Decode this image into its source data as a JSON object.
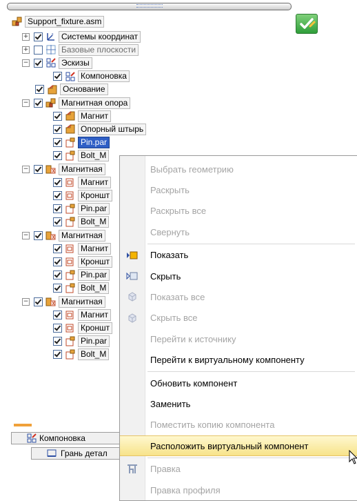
{
  "root": {
    "label": "Support_fixture.asm"
  },
  "tree": [
    {
      "label": "Системы координат",
      "expander": "+",
      "checked": true,
      "icon": "coordinate-system-icon",
      "gray": false
    },
    {
      "label": "Базовые плоскости",
      "expander": "+",
      "checked": false,
      "icon": "reference-planes-icon",
      "gray": true
    },
    {
      "label": "Эскизы",
      "expander": "−",
      "checked": true,
      "icon": "sketch-icon",
      "gray": false
    },
    {
      "label": "Компоновка",
      "expander": "",
      "checked": true,
      "icon": "sketch-icon",
      "gray": false
    },
    {
      "label": "Основание",
      "expander": "",
      "checked": true,
      "icon": "part-icon",
      "gray": false
    },
    {
      "label": "Магнитная опора",
      "expander": "−",
      "checked": true,
      "icon": "subassembly-icon",
      "gray": false
    },
    {
      "label": "Магнит",
      "expander": "",
      "checked": true,
      "icon": "part-icon",
      "gray": false
    },
    {
      "label": "Опорный штырь",
      "expander": "",
      "checked": true,
      "icon": "part-icon",
      "gray": false
    },
    {
      "label": "Pin.par",
      "expander": "",
      "checked": true,
      "icon": "virtual-part-icon",
      "gray": false,
      "selected": true
    },
    {
      "label": "Bolt_M",
      "expander": "",
      "checked": true,
      "icon": "virtual-part-icon",
      "gray": false
    },
    {
      "label": "Магнитная",
      "expander": "−",
      "checked": true,
      "icon": "virtual-assembly-icon",
      "gray": false
    },
    {
      "label": "Магнит",
      "expander": "",
      "checked": true,
      "icon": "virtual-assembly-part-icon",
      "gray": false
    },
    {
      "label": "Кроншт",
      "expander": "",
      "checked": true,
      "icon": "virtual-assembly-part-icon",
      "gray": false
    },
    {
      "label": "Pin.par",
      "expander": "",
      "checked": true,
      "icon": "virtual-part-icon",
      "gray": false
    },
    {
      "label": "Bolt_M",
      "expander": "",
      "checked": true,
      "icon": "virtual-part-icon",
      "gray": false
    },
    {
      "label": "Магнитная",
      "expander": "−",
      "checked": true,
      "icon": "virtual-assembly-icon",
      "gray": false
    },
    {
      "label": "Магнит",
      "expander": "",
      "checked": true,
      "icon": "virtual-assembly-part-icon",
      "gray": false
    },
    {
      "label": "Кроншт",
      "expander": "",
      "checked": true,
      "icon": "virtual-assembly-part-icon",
      "gray": false
    },
    {
      "label": "Pin.par",
      "expander": "",
      "checked": true,
      "icon": "virtual-part-icon",
      "gray": false
    },
    {
      "label": "Bolt_M",
      "expander": "",
      "checked": true,
      "icon": "virtual-part-icon",
      "gray": false
    },
    {
      "label": "Магнитная",
      "expander": "−",
      "checked": true,
      "icon": "virtual-assembly-icon",
      "gray": false
    },
    {
      "label": "Магнит",
      "expander": "",
      "checked": true,
      "icon": "virtual-assembly-part-icon",
      "gray": false
    },
    {
      "label": "Кроншт",
      "expander": "",
      "checked": true,
      "icon": "virtual-assembly-part-icon",
      "gray": false
    },
    {
      "label": "Pin.par",
      "expander": "",
      "checked": true,
      "icon": "virtual-part-icon",
      "gray": false
    },
    {
      "label": "Bolt_M",
      "expander": "",
      "checked": true,
      "icon": "virtual-part-icon",
      "gray": false
    }
  ],
  "bottom": {
    "layout_label": "Компоновка",
    "face_label": "Грань детал"
  },
  "menu": [
    {
      "label": "Выбрать геометрию",
      "disabled": true,
      "icon": ""
    },
    {
      "label": "Раскрыть",
      "disabled": true,
      "icon": ""
    },
    {
      "label": "Раскрыть все",
      "disabled": true,
      "icon": ""
    },
    {
      "label": "Свернуть",
      "disabled": true,
      "icon": ""
    },
    {
      "label": "Показать",
      "disabled": false,
      "icon": "show-icon",
      "sep_before": true
    },
    {
      "label": "Скрыть",
      "disabled": false,
      "icon": "hide-icon"
    },
    {
      "label": "Показать все",
      "disabled": true,
      "icon": "show-all-icon"
    },
    {
      "label": "Скрыть все",
      "disabled": true,
      "icon": "hide-all-icon"
    },
    {
      "label": "Перейти к источнику",
      "disabled": true,
      "icon": ""
    },
    {
      "label": "Перейти к виртуальному компоненту",
      "disabled": false,
      "icon": ""
    },
    {
      "label": "Обновить компонент",
      "disabled": false,
      "icon": "",
      "sep_before": true
    },
    {
      "label": "Заменить",
      "disabled": false,
      "icon": ""
    },
    {
      "label": "Поместить копию компонента",
      "disabled": true,
      "icon": ""
    },
    {
      "label": "Расположить виртуальный компонент",
      "disabled": false,
      "icon": "",
      "hover": true
    },
    {
      "label": "Правка",
      "disabled": true,
      "icon": "edit-icon",
      "sep_before": true
    },
    {
      "label": "Правка профиля",
      "disabled": true,
      "icon": ""
    }
  ],
  "colors": {
    "selection": "#2f5fc6",
    "hover": "#f7e38a",
    "accent_badge": "#f0a13a"
  }
}
